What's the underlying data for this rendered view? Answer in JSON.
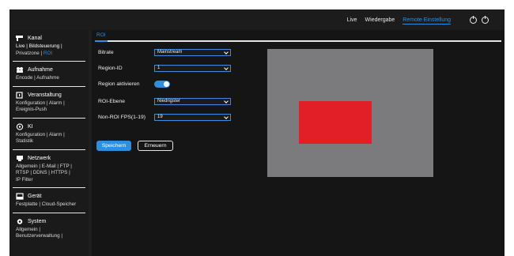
{
  "topnav": {
    "items": [
      "Live",
      "Wiedergabe",
      "Remote Einstellung"
    ],
    "active": "Remote Einstellung"
  },
  "sidebar": {
    "groups": [
      {
        "icon": "camera-icon",
        "title": "Kanal",
        "lines": [
          "Live | Bildsteuerung |",
          "Privatzone | ",
          "ROI"
        ]
      },
      {
        "icon": "recording-icon",
        "title": "Aufnahme",
        "lines": [
          "Encode | Aufnahme"
        ]
      },
      {
        "icon": "event-icon",
        "title": "Veranstaltung",
        "lines": [
          "Konfiguration | Alarm |",
          "Ereignis-Push"
        ]
      },
      {
        "icon": "ai-icon",
        "title": "KI",
        "lines": [
          "Konfiguration | Alarm |",
          "Statistik"
        ]
      },
      {
        "icon": "network-icon",
        "title": "Netzwerk",
        "lines": [
          "Allgemein | E-Mail | FTP |",
          "RTSP | DDNS | HTTPS |",
          "IP Filter"
        ]
      },
      {
        "icon": "device-icon",
        "title": "Gerät",
        "lines": [
          "Festplatte | Cloud-Speicher"
        ]
      },
      {
        "icon": "system-icon",
        "title": "System",
        "lines": [
          "Allgemein |",
          "Benutzerverwaltung |"
        ]
      }
    ]
  },
  "tab": {
    "label": "ROI"
  },
  "form": {
    "bitrate": {
      "label": "Bitrate",
      "value": "Mainstream"
    },
    "region_id": {
      "label": "Region-ID",
      "value": "1"
    },
    "region_enable": {
      "label": "Region aktivieren",
      "enabled": true
    },
    "roi_level": {
      "label": "ROI-Ebene",
      "value": "Niedrigster"
    },
    "nonroi_fps": {
      "label": "Non-ROI FPS(1-19)",
      "value": "19"
    }
  },
  "buttons": {
    "save": "Speichern",
    "reset": "Erneuern"
  },
  "colors": {
    "accent": "#2e8fe0",
    "region": "#e21e26",
    "preview_bg": "#7b7b7d"
  }
}
